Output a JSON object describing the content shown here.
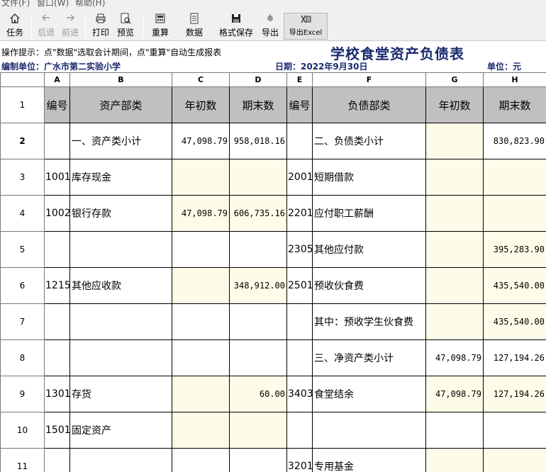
{
  "menu": [
    "文件(F)",
    "窗口(W)",
    "帮助(H)"
  ],
  "toolbar": {
    "task": "任务",
    "first": "后退",
    "next": "前进",
    "print": "打印",
    "preview": "预览",
    "recalc": "重算",
    "data": "数据",
    "save_format": "格式保存",
    "export": "导出",
    "export_excel": "导出Excel"
  },
  "hint": "操作提示：点\"数据\"选取会计期间，点\"重算\"自动生成报表",
  "report_title": "学校食堂资产负债表",
  "info": {
    "unit_label": "编制单位：广水市第二实验小学",
    "date_label": "日期：2022年9月30日",
    "currency_label": "单位：元"
  },
  "columns": [
    "A",
    "B",
    "C",
    "D",
    "E",
    "F",
    "G",
    "H"
  ],
  "headers": {
    "code": "编号",
    "asset_category": "资产部类",
    "year_begin": "年初数",
    "period_end": "期末数",
    "code2": "编号",
    "liability_category": "负债部类",
    "year_begin2": "年初数",
    "period_end2": "期末数"
  },
  "rows": [
    {
      "n": "1"
    },
    {
      "n": "2",
      "a": "",
      "b": "一、资产类小计",
      "c": "47,098.79",
      "d": "958,018.16",
      "e": "",
      "f": "二、负债类小计",
      "g": "",
      "h": "830,823.90"
    },
    {
      "n": "3",
      "a": "1001",
      "b": "库存现金",
      "c": "",
      "d": "",
      "e": "2001",
      "f": "短期借款",
      "g": "",
      "h": ""
    },
    {
      "n": "4",
      "a": "1002",
      "b": "银行存款",
      "c": "47,098.79",
      "d": "606,735.16",
      "e": "2201",
      "f": "应付职工薪酬",
      "g": "",
      "h": ""
    },
    {
      "n": "5",
      "a": "",
      "b": "",
      "c": "",
      "d": "",
      "e": "2305",
      "f": "其他应付款",
      "g": "",
      "h": "395,283.90"
    },
    {
      "n": "6",
      "a": "1215",
      "b": "其他应收款",
      "c": "",
      "d": "348,912.00",
      "e": "2501",
      "f": "预收伙食费",
      "g": "",
      "h": "435,540.00"
    },
    {
      "n": "7",
      "a": "",
      "b": "",
      "c": "",
      "d": "",
      "e": "",
      "f": "其中：预收学生伙食费",
      "g": "",
      "h": "435,540.00"
    },
    {
      "n": "8",
      "a": "",
      "b": "",
      "c": "",
      "d": "",
      "e": "",
      "f": "三、净资产类小计",
      "g": "47,098.79",
      "h": "127,194.26"
    },
    {
      "n": "9",
      "a": "1301",
      "b": "存货",
      "c": "",
      "d": "60.00",
      "e": "3403",
      "f": "食堂结余",
      "g": "47,098.79",
      "h": "127,194.26"
    },
    {
      "n": "10",
      "a": "1501",
      "b": "固定资产",
      "c": "",
      "d": "",
      "e": "",
      "f": "",
      "g": "",
      "h": ""
    },
    {
      "n": "11",
      "a": "",
      "b": "",
      "c": "",
      "d": "",
      "e": "3201",
      "f": "专用基金",
      "g": "",
      "h": ""
    }
  ],
  "colors": {
    "header_gray": "#c0c0c0",
    "input_yellow": "#fefce8",
    "title_navy": "#1a2a6e"
  }
}
